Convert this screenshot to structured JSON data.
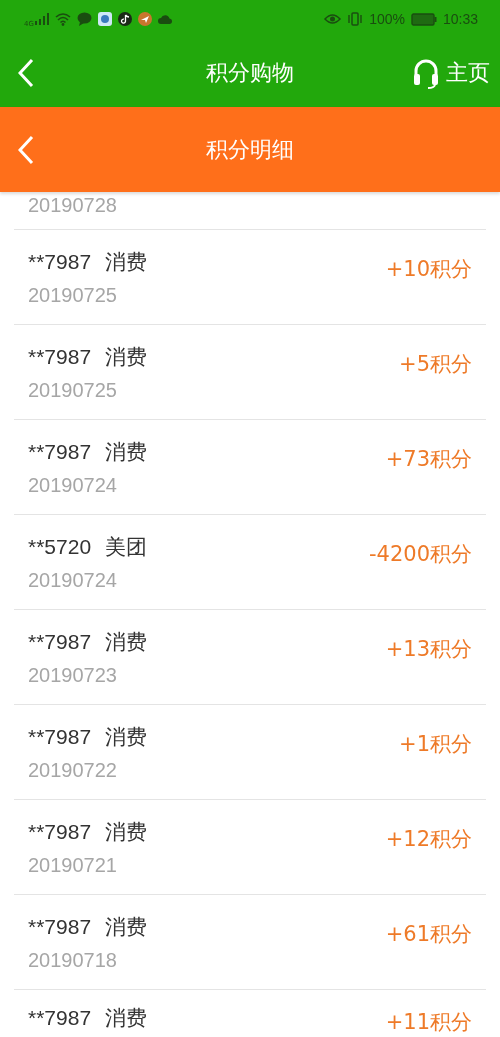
{
  "status_bar": {
    "network": "4G",
    "battery": "100%",
    "time": "10:33"
  },
  "top_bar": {
    "title": "积分购物",
    "home": "主页"
  },
  "sub_bar": {
    "title": "积分明细"
  },
  "records": [
    {
      "date": "20190728"
    },
    {
      "title": "**7987",
      "type": "消费",
      "date": "20190725",
      "points": "+10积分"
    },
    {
      "title": "**7987",
      "type": "消费",
      "date": "20190725",
      "points": "+5积分"
    },
    {
      "title": "**7987",
      "type": "消费",
      "date": "20190724",
      "points": "+73积分"
    },
    {
      "title": "**5720",
      "type": "美团",
      "date": "20190724",
      "points": "-4200积分"
    },
    {
      "title": "**7987",
      "type": "消费",
      "date": "20190723",
      "points": "+13积分"
    },
    {
      "title": "**7987",
      "type": "消费",
      "date": "20190722",
      "points": "+1积分"
    },
    {
      "title": "**7987",
      "type": "消费",
      "date": "20190721",
      "points": "+12积分"
    },
    {
      "title": "**7987",
      "type": "消费",
      "date": "20190718",
      "points": "+61积分"
    },
    {
      "title": "**7987",
      "type": "消费",
      "points": "+11积分"
    }
  ]
}
